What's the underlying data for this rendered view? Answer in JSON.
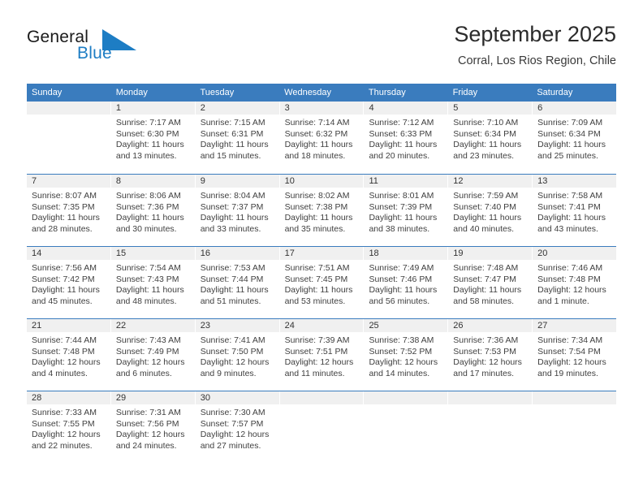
{
  "brand": {
    "name_part1": "General",
    "name_part2": "Blue",
    "triangle_color": "#1d7dc4",
    "text_color": "#1a1a1a"
  },
  "header": {
    "title": "September 2025",
    "subtitle": "Corral, Los Rios Region, Chile"
  },
  "theme": {
    "header_blue": "#3a7cbe",
    "day_number_bg": "#f0f0f0",
    "text": "#404040"
  },
  "weekdays": [
    "Sunday",
    "Monday",
    "Tuesday",
    "Wednesday",
    "Thursday",
    "Friday",
    "Saturday"
  ],
  "weeks": [
    [
      {
        "day": "",
        "sunrise": "",
        "sunset": "",
        "daylight": ""
      },
      {
        "day": "1",
        "sunrise": "Sunrise: 7:17 AM",
        "sunset": "Sunset: 6:30 PM",
        "daylight": "Daylight: 11 hours and 13 minutes."
      },
      {
        "day": "2",
        "sunrise": "Sunrise: 7:15 AM",
        "sunset": "Sunset: 6:31 PM",
        "daylight": "Daylight: 11 hours and 15 minutes."
      },
      {
        "day": "3",
        "sunrise": "Sunrise: 7:14 AM",
        "sunset": "Sunset: 6:32 PM",
        "daylight": "Daylight: 11 hours and 18 minutes."
      },
      {
        "day": "4",
        "sunrise": "Sunrise: 7:12 AM",
        "sunset": "Sunset: 6:33 PM",
        "daylight": "Daylight: 11 hours and 20 minutes."
      },
      {
        "day": "5",
        "sunrise": "Sunrise: 7:10 AM",
        "sunset": "Sunset: 6:34 PM",
        "daylight": "Daylight: 11 hours and 23 minutes."
      },
      {
        "day": "6",
        "sunrise": "Sunrise: 7:09 AM",
        "sunset": "Sunset: 6:34 PM",
        "daylight": "Daylight: 11 hours and 25 minutes."
      }
    ],
    [
      {
        "day": "7",
        "sunrise": "Sunrise: 8:07 AM",
        "sunset": "Sunset: 7:35 PM",
        "daylight": "Daylight: 11 hours and 28 minutes."
      },
      {
        "day": "8",
        "sunrise": "Sunrise: 8:06 AM",
        "sunset": "Sunset: 7:36 PM",
        "daylight": "Daylight: 11 hours and 30 minutes."
      },
      {
        "day": "9",
        "sunrise": "Sunrise: 8:04 AM",
        "sunset": "Sunset: 7:37 PM",
        "daylight": "Daylight: 11 hours and 33 minutes."
      },
      {
        "day": "10",
        "sunrise": "Sunrise: 8:02 AM",
        "sunset": "Sunset: 7:38 PM",
        "daylight": "Daylight: 11 hours and 35 minutes."
      },
      {
        "day": "11",
        "sunrise": "Sunrise: 8:01 AM",
        "sunset": "Sunset: 7:39 PM",
        "daylight": "Daylight: 11 hours and 38 minutes."
      },
      {
        "day": "12",
        "sunrise": "Sunrise: 7:59 AM",
        "sunset": "Sunset: 7:40 PM",
        "daylight": "Daylight: 11 hours and 40 minutes."
      },
      {
        "day": "13",
        "sunrise": "Sunrise: 7:58 AM",
        "sunset": "Sunset: 7:41 PM",
        "daylight": "Daylight: 11 hours and 43 minutes."
      }
    ],
    [
      {
        "day": "14",
        "sunrise": "Sunrise: 7:56 AM",
        "sunset": "Sunset: 7:42 PM",
        "daylight": "Daylight: 11 hours and 45 minutes."
      },
      {
        "day": "15",
        "sunrise": "Sunrise: 7:54 AM",
        "sunset": "Sunset: 7:43 PM",
        "daylight": "Daylight: 11 hours and 48 minutes."
      },
      {
        "day": "16",
        "sunrise": "Sunrise: 7:53 AM",
        "sunset": "Sunset: 7:44 PM",
        "daylight": "Daylight: 11 hours and 51 minutes."
      },
      {
        "day": "17",
        "sunrise": "Sunrise: 7:51 AM",
        "sunset": "Sunset: 7:45 PM",
        "daylight": "Daylight: 11 hours and 53 minutes."
      },
      {
        "day": "18",
        "sunrise": "Sunrise: 7:49 AM",
        "sunset": "Sunset: 7:46 PM",
        "daylight": "Daylight: 11 hours and 56 minutes."
      },
      {
        "day": "19",
        "sunrise": "Sunrise: 7:48 AM",
        "sunset": "Sunset: 7:47 PM",
        "daylight": "Daylight: 11 hours and 58 minutes."
      },
      {
        "day": "20",
        "sunrise": "Sunrise: 7:46 AM",
        "sunset": "Sunset: 7:48 PM",
        "daylight": "Daylight: 12 hours and 1 minute."
      }
    ],
    [
      {
        "day": "21",
        "sunrise": "Sunrise: 7:44 AM",
        "sunset": "Sunset: 7:48 PM",
        "daylight": "Daylight: 12 hours and 4 minutes."
      },
      {
        "day": "22",
        "sunrise": "Sunrise: 7:43 AM",
        "sunset": "Sunset: 7:49 PM",
        "daylight": "Daylight: 12 hours and 6 minutes."
      },
      {
        "day": "23",
        "sunrise": "Sunrise: 7:41 AM",
        "sunset": "Sunset: 7:50 PM",
        "daylight": "Daylight: 12 hours and 9 minutes."
      },
      {
        "day": "24",
        "sunrise": "Sunrise: 7:39 AM",
        "sunset": "Sunset: 7:51 PM",
        "daylight": "Daylight: 12 hours and 11 minutes."
      },
      {
        "day": "25",
        "sunrise": "Sunrise: 7:38 AM",
        "sunset": "Sunset: 7:52 PM",
        "daylight": "Daylight: 12 hours and 14 minutes."
      },
      {
        "day": "26",
        "sunrise": "Sunrise: 7:36 AM",
        "sunset": "Sunset: 7:53 PM",
        "daylight": "Daylight: 12 hours and 17 minutes."
      },
      {
        "day": "27",
        "sunrise": "Sunrise: 7:34 AM",
        "sunset": "Sunset: 7:54 PM",
        "daylight": "Daylight: 12 hours and 19 minutes."
      }
    ],
    [
      {
        "day": "28",
        "sunrise": "Sunrise: 7:33 AM",
        "sunset": "Sunset: 7:55 PM",
        "daylight": "Daylight: 12 hours and 22 minutes."
      },
      {
        "day": "29",
        "sunrise": "Sunrise: 7:31 AM",
        "sunset": "Sunset: 7:56 PM",
        "daylight": "Daylight: 12 hours and 24 minutes."
      },
      {
        "day": "30",
        "sunrise": "Sunrise: 7:30 AM",
        "sunset": "Sunset: 7:57 PM",
        "daylight": "Daylight: 12 hours and 27 minutes."
      },
      {
        "day": "",
        "sunrise": "",
        "sunset": "",
        "daylight": ""
      },
      {
        "day": "",
        "sunrise": "",
        "sunset": "",
        "daylight": ""
      },
      {
        "day": "",
        "sunrise": "",
        "sunset": "",
        "daylight": ""
      },
      {
        "day": "",
        "sunrise": "",
        "sunset": "",
        "daylight": ""
      }
    ]
  ]
}
